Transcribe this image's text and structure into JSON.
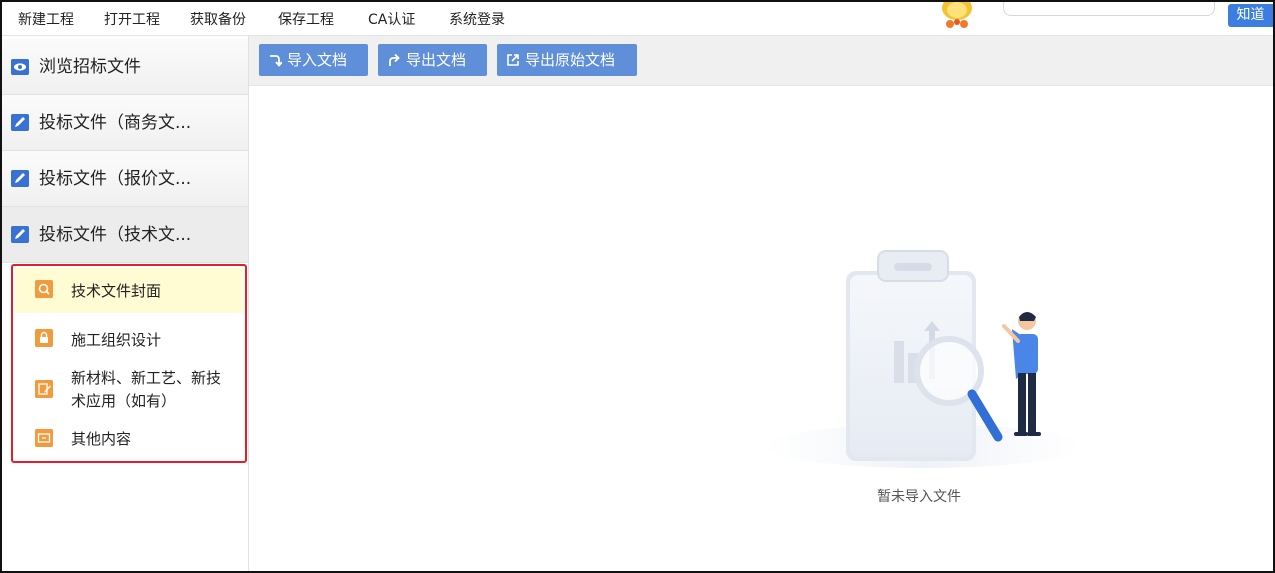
{
  "menu": {
    "items": [
      "新建工程",
      "打开工程",
      "获取备份",
      "保存工程",
      "CA认证",
      "系统登录"
    ],
    "know_button": "知道"
  },
  "sidebar": {
    "items": [
      {
        "label": "浏览招标文件",
        "icon": "eye-icon"
      },
      {
        "label": "投标文件（商务文...",
        "icon": "edit-icon"
      },
      {
        "label": "投标文件（报价文...",
        "icon": "edit-icon"
      },
      {
        "label": "投标文件（技术文...",
        "icon": "edit-icon"
      }
    ],
    "sub_items": [
      {
        "label": "技术文件封面",
        "icon": "search-document-icon"
      },
      {
        "label": "施工组织设计",
        "icon": "lock-document-icon"
      },
      {
        "label_line1": "新材料、新工艺、新技",
        "label_line2": "术应用（如有）",
        "icon": "edit-document-icon"
      },
      {
        "label": "其他内容",
        "icon": "box-icon"
      }
    ]
  },
  "toolbar": {
    "import_label": "导入文档",
    "export_label": "导出文档",
    "export_original_label": "导出原始文档"
  },
  "main": {
    "empty_text": "暂未导入文件"
  },
  "colors": {
    "accent_blue": "#3b7ee0",
    "toolbar_button": "#5e8fd8",
    "highlight_border": "#e0212b",
    "selected_bg": "#fffbd3",
    "sub_icon_orange": "#f29b3d"
  }
}
